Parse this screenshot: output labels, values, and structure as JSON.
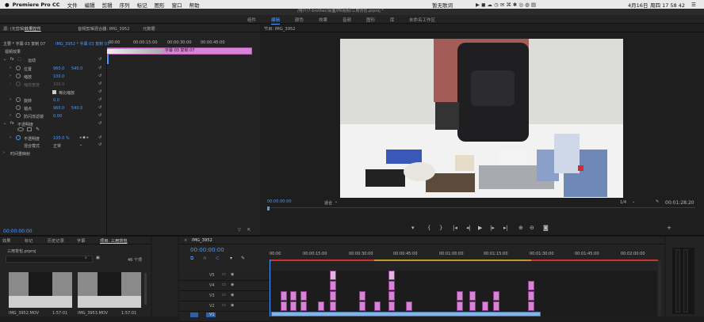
{
  "menubar": {
    "app": "Premiere Pro CC",
    "items": [
      "文件",
      "编辑",
      "剪辑",
      "序列",
      "标记",
      "图形",
      "窗口",
      "帮助"
    ],
    "center": "暂无歌词",
    "clock": "周四 17 58 42",
    "date": "4月16日"
  },
  "titlebar": {
    "path": "/用户/7-brother/桌面/PR视频/三用背包.prproj *"
  },
  "workspaces": [
    "组件",
    "编辑",
    "颜色",
    "效果",
    "音频",
    "图形",
    "库",
    "未命名工作区"
  ],
  "effect_controls": {
    "tabs": [
      "源: (无剪辑)",
      "效果控件",
      "音频剪辑混合器: IMG_3952",
      "元数据"
    ],
    "clip_path": "主要 * 字幕 03 复制 07",
    "clip_seq": "IMG_3952 * 字幕 03 复制 07",
    "times": [
      "00:00",
      "00:00:15:00",
      "00:00:30:00",
      "00:00:45:00"
    ],
    "clip_label": "字幕 03 复制 07",
    "section": "视频效果",
    "motion": "运动",
    "params": [
      {
        "name": "位置",
        "v1": "960.0",
        "v2": "540.0"
      },
      {
        "name": "缩放",
        "v1": "100.0",
        "v2": ""
      },
      {
        "name": "缩放宽度",
        "v1": "100.0",
        "v2": ""
      },
      {
        "name": "",
        "v1": "等比缩放",
        "v2": ""
      },
      {
        "name": "旋转",
        "v1": "0.0",
        "v2": ""
      },
      {
        "name": "锚点",
        "v1": "960.0",
        "v2": "540.0"
      },
      {
        "name": "防闪烁滤镜",
        "v1": "0.00",
        "v2": ""
      }
    ],
    "opacity_section": "不透明度",
    "opacity_label": "不透明度",
    "opacity_value": "100.0 %",
    "blend_label": "混合模式",
    "blend_value": "正常",
    "timeremap": "时间重映射",
    "timecode": "00:00:00:00"
  },
  "program": {
    "title": "节目: IMG_3952",
    "timecode": "00:00:00:00",
    "fit": "适合",
    "scale": "1/4",
    "duration": "00:01:28:20"
  },
  "project": {
    "tabs": [
      "效果",
      "标记",
      "历史记录",
      "字幕",
      "项目: 三用背包"
    ],
    "name": "三用背包.prproj",
    "count": "46 个项",
    "items": [
      {
        "name": "IMG_3952.MOV",
        "dur": "1:57:01"
      },
      {
        "name": "IMG_3953.MOV",
        "dur": "1:57:01"
      }
    ]
  },
  "timeline": {
    "tab": "IMG_3952",
    "timecode": "00:00:00:00",
    "ruler": [
      "00:00",
      "00:00:15:00",
      "00:00:30:00",
      "00:00:45:00",
      "00:01:00:00",
      "00:01:15:00",
      "00:01:30:00",
      "00:01:45:00",
      "00:02:00:00"
    ],
    "tracks": [
      "V5",
      "V4",
      "V3",
      "V2",
      "V1"
    ]
  },
  "colors": {
    "accent": "#4a9bff",
    "clip": "#d784d6",
    "panel": "#232323"
  }
}
